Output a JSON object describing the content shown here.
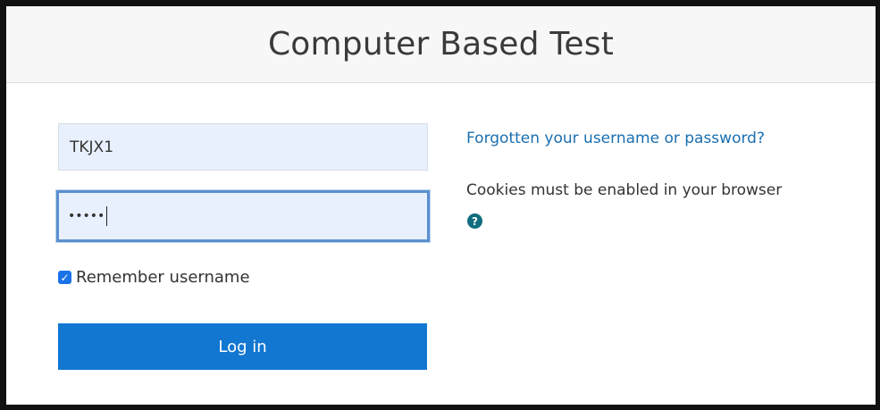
{
  "header": {
    "title": "Computer Based Test"
  },
  "login_form": {
    "username_value": "TKJX1",
    "password_value": "•••••",
    "remember_label": "Remember username",
    "remember_checked": true,
    "login_button_label": "Log in"
  },
  "side_info": {
    "forgot_link": "Forgotten your username or password?",
    "cookies_notice": "Cookies must be enabled in your browser",
    "help_icon": "question-circle-icon"
  },
  "colors": {
    "primary": "#1177d1",
    "link": "#1a6fb0",
    "input_bg": "#e8f0fe",
    "focus_border": "#5a90cf",
    "help_icon": "#0f6d7e"
  }
}
